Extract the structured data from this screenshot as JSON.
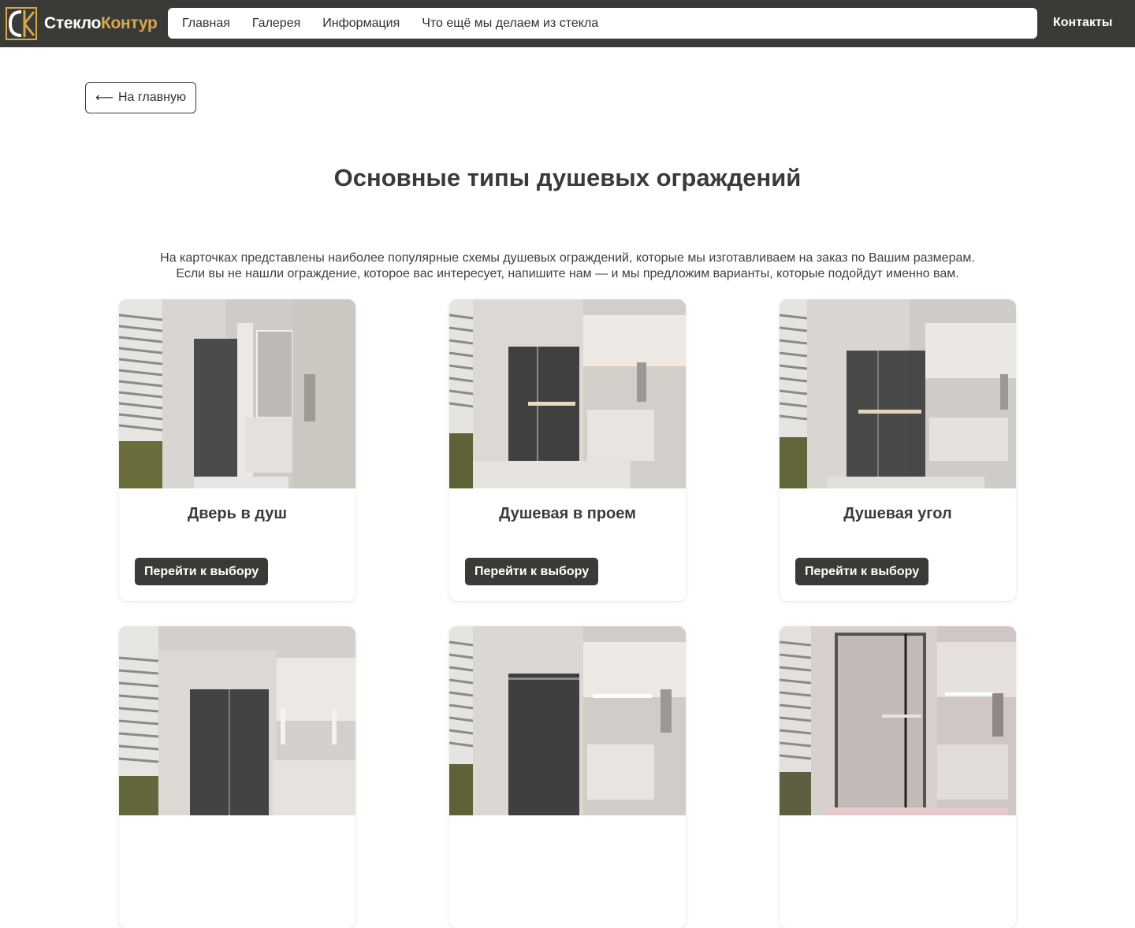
{
  "header": {
    "logo_text_part1": "Стекло",
    "logo_text_part2": "Контур",
    "logo_mark_letters": "СК",
    "nav": [
      {
        "label": "Главная"
      },
      {
        "label": "Галерея"
      },
      {
        "label": "Информация"
      },
      {
        "label": "Что ещё мы делаем из стекла"
      }
    ],
    "contacts_label": "Контакты",
    "colors": {
      "bar": "#3a3b37",
      "brand_accent": "#d9a84a"
    }
  },
  "back_button": {
    "arrow": "⟵",
    "label": "На главную"
  },
  "page_title": "Основные типы душевых ограждений",
  "intro": {
    "line1": "На карточках представлены наиболее популярные схемы душевых ограждений, которые мы изготавливаем на заказ по Вашим размерам.",
    "line2": "Если вы не нашли ограждение, которое вас интересует, напишите нам — и мы предложим варианты, которые подойдут именно вам."
  },
  "cards": [
    {
      "title": "Дверь в душ",
      "button": "Перейти к выбору",
      "image_icon": "shower-door-image"
    },
    {
      "title": "Душевая в проем",
      "button": "Перейти к выбору",
      "image_icon": "shower-niche-image"
    },
    {
      "title": "Душевая угол",
      "button": "Перейти к выбору",
      "image_icon": "shower-corner-image"
    },
    {
      "title": "",
      "button": "",
      "image_icon": "shower-corner-image"
    },
    {
      "title": "",
      "button": "",
      "image_icon": "shower-sliding-image"
    },
    {
      "title": "",
      "button": "",
      "image_icon": "shower-black-frame-image"
    }
  ]
}
